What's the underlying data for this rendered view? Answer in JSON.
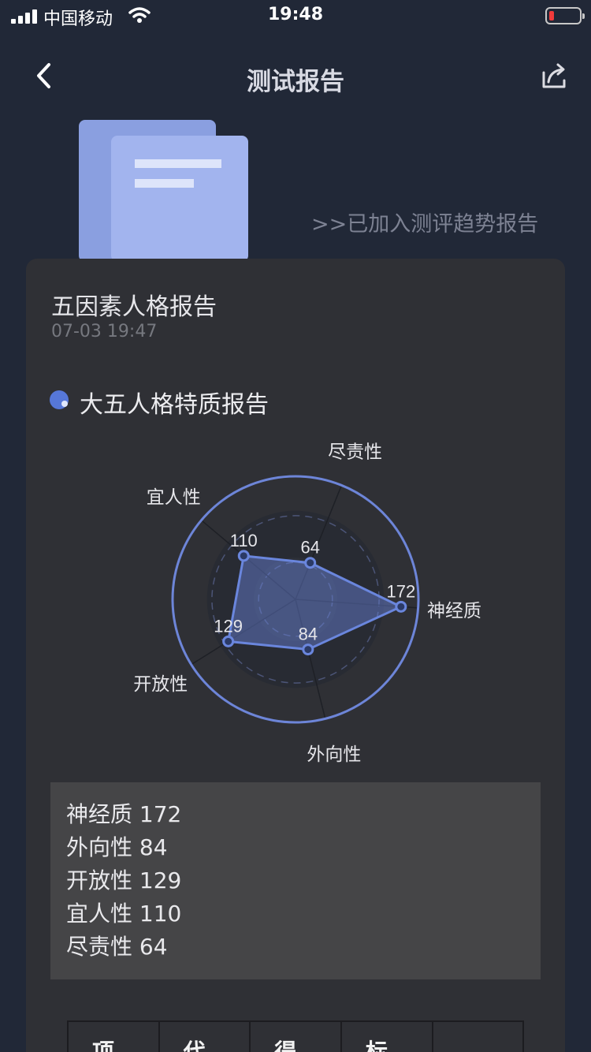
{
  "status_bar": {
    "carrier": "中国移动",
    "time": "19:48"
  },
  "nav": {
    "title": "测试报告"
  },
  "trend_link": ">>已加入测评趋势报告",
  "report": {
    "title": "五因素人格报告",
    "date": "07-03 19:47",
    "section_title": "大五人格特质报告"
  },
  "chart_data": {
    "type": "radar",
    "categories": [
      "神经质",
      "外向性",
      "开放性",
      "宜人性",
      "尽责性"
    ],
    "values": [
      172,
      84,
      129,
      110,
      64
    ],
    "rlim": [
      0,
      200
    ],
    "grid": true,
    "colors": {
      "series": "#6a86dd",
      "axis_ring": "#6d85d8"
    }
  },
  "summary": [
    "神经质 172",
    "外向性 84",
    "开放性 129",
    "宜人性 110",
    "尽责性 64"
  ],
  "table": {
    "headers": [
      "项",
      "代",
      "得",
      "标",
      ""
    ]
  },
  "colors": {
    "background": "#212837",
    "card": "#2f3035",
    "accent": "#5677d8",
    "doc_illustration": "#a2b4ee"
  }
}
